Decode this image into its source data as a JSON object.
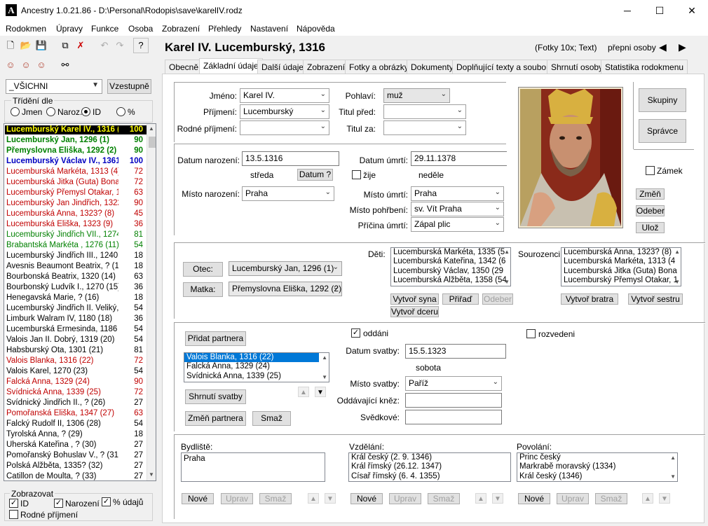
{
  "window": {
    "title": "Ancestry 1.0.21.86 - D:\\Personal\\Rodopis\\save\\karelIV.rodz",
    "app_icon": "A",
    "minimize": "─",
    "maximize": "☐",
    "close": "✕"
  },
  "menu": [
    "Rodokmen",
    "Úpravy",
    "Funkce",
    "Osoba",
    "Zobrazení",
    "Přehledy",
    "Nastavení",
    "Nápověda"
  ],
  "left": {
    "filter": "_VŠICHNI",
    "sort_direction_button": "Vzestupně",
    "sort_label": "Třídění dle",
    "sort_options": [
      "Jmen",
      "Naroz.",
      "ID",
      "%"
    ],
    "sort_selected": "ID",
    "persons": [
      {
        "name": "Lucemburský Karel IV., 1316 (1)",
        "num": "100",
        "color": "#000000",
        "bold": true,
        "selected": true
      },
      {
        "name": "Lucemburský Jan, 1296 (1)",
        "num": "90",
        "color": "#008000",
        "bold": true
      },
      {
        "name": "Přemyslovna Eliška, 1292 (2)",
        "num": "90",
        "color": "#008000",
        "bold": true
      },
      {
        "name": "Lucemburský Václav IV., 1361",
        "num": "100",
        "color": "#0000c0",
        "bold": true
      },
      {
        "name": "Lucemburská Markéta, 1313 (4)",
        "num": "72",
        "color": "#c00000"
      },
      {
        "name": "Lucemburská Jitka (Guta) Bona, 1",
        "num": "72",
        "color": "#c00000"
      },
      {
        "name": "Lucemburský Přemysl Otakar, 1318",
        "num": "63",
        "color": "#c00000"
      },
      {
        "name": "Lucemburský Jan Jindřich, 1322 (",
        "num": "90",
        "color": "#c00000"
      },
      {
        "name": "Lucemburská Anna, 1323? (8)",
        "num": "45",
        "color": "#c00000"
      },
      {
        "name": "Lucemburská Eliška, 1323 (9)",
        "num": "36",
        "color": "#c00000"
      },
      {
        "name": "Lucemburský Jindřich VII., 1274 (",
        "num": "81",
        "color": "#008000"
      },
      {
        "name": "Brabantská Markéta , 1276 (11)",
        "num": "54",
        "color": "#008000"
      },
      {
        "name": "Lucemburský Jindřich III., 1240 (1",
        "num": "18",
        "color": "#000000"
      },
      {
        "name": "Avesnis Beaumont Beatrix, ? (13)",
        "num": "18",
        "color": "#000000"
      },
      {
        "name": "Bourbonská Beatrix, 1320 (14)",
        "num": "63",
        "color": "#000000"
      },
      {
        "name": "Bourbonský Ludvík I., 1270 (15)",
        "num": "36",
        "color": "#000000"
      },
      {
        "name": "Henegavská Marie, ? (16)",
        "num": "18",
        "color": "#000000"
      },
      {
        "name": "Lucemburský Jindřich II. Veliký, 1",
        "num": "54",
        "color": "#000000"
      },
      {
        "name": "Limburk Walram IV, 1180 (18)",
        "num": "36",
        "color": "#000000"
      },
      {
        "name": "Lucemburská Ermesinda, 1186 (1",
        "num": "54",
        "color": "#000000"
      },
      {
        "name": "Valois Jan II. Dobrý, 1319 (20)",
        "num": "54",
        "color": "#000000"
      },
      {
        "name": "Habsburský Ota, 1301 (21)",
        "num": "81",
        "color": "#000000"
      },
      {
        "name": "Valois Blanka, 1316 (22)",
        "num": "72",
        "color": "#c00000"
      },
      {
        "name": "Valois Karel, 1270 (23)",
        "num": "54",
        "color": "#000000"
      },
      {
        "name": "Falcká Anna, 1329 (24)",
        "num": "90",
        "color": "#c00000"
      },
      {
        "name": "Svídnická Anna, 1339 (25)",
        "num": "72",
        "color": "#c00000"
      },
      {
        "name": "Svídnický Jindřich II., ? (26)",
        "num": "27",
        "color": "#000000"
      },
      {
        "name": "Pomořanská Eliška, 1347 (27)",
        "num": "63",
        "color": "#c00000"
      },
      {
        "name": "Falcký Rudolf II, 1306 (28)",
        "num": "54",
        "color": "#000000"
      },
      {
        "name": "Tyrolská Anna, ? (29)",
        "num": "18",
        "color": "#000000"
      },
      {
        "name": "Uherská Kateřina , ? (30)",
        "num": "27",
        "color": "#000000"
      },
      {
        "name": "Pomořanský Bohuslav V., ? (31)",
        "num": "27",
        "color": "#000000"
      },
      {
        "name": "Polská Alžběta, 1335? (32)",
        "num": "27",
        "color": "#000000"
      },
      {
        "name": "Catillon de Moulta, ? (33)",
        "num": "27",
        "color": "#000000"
      }
    ],
    "display_group": "Zobrazovat",
    "display_opts": [
      {
        "label": "ID",
        "checked": true
      },
      {
        "label": "Narození",
        "checked": true
      },
      {
        "label": "% údajů",
        "checked": true
      },
      {
        "label": "Rodné příjmení",
        "checked": false
      }
    ]
  },
  "header": {
    "person": "Karel IV. Lucemburský, 1316",
    "photos": "(Fotky 10x; Text)",
    "switch": "přepni osoby"
  },
  "tabs": [
    "Obecně",
    "Základní údaje",
    "Další údaje",
    "Zobrazení",
    "Fotky a obrázky",
    "Dokumenty",
    "Doplňující texty a soubory",
    "Shrnutí osoby",
    "Statistika rodokmenu"
  ],
  "active_tab": 1,
  "basic": {
    "name_label": "Jméno:",
    "name": "Karel IV.",
    "surname_label": "Příjmení:",
    "surname": "Lucemburský",
    "birth_surname_label": "Rodné příjmení:",
    "birth_surname": "",
    "sex_label": "Pohlaví:",
    "sex": "muž",
    "title_before_label": "Titul před:",
    "title_before": "",
    "title_after_label": "Titul za:",
    "title_after": "",
    "birth_date_label": "Datum narození:",
    "birth_date": "13.5.1316",
    "birth_weekday": "středa",
    "date_button": "Datum ?",
    "birth_place_label": "Místo narození:",
    "birth_place": "Praha",
    "death_date_label": "Datum úmrtí:",
    "death_date": "29.11.1378",
    "alive_label": "žije",
    "death_weekday": "neděle",
    "death_place_label": "Místo úmrtí:",
    "death_place": "Praha",
    "burial_place_label": "Místo pohřbení:",
    "burial_place": "sv. Vít Praha",
    "death_cause_label": "Příčina úmrtí:",
    "death_cause": "Zápal plic"
  },
  "side": {
    "groups": "Skupiny",
    "admin": "Správce",
    "lock": "Zámek",
    "change": "Změň",
    "remove": "Odeber",
    "save": "Ulož"
  },
  "family": {
    "father_btn": "Otec:",
    "father": "Lucemburský Jan, 1296 (1)",
    "mother_btn": "Matka:",
    "mother": "Přemyslovna Eliška, 1292 (2)",
    "children_label": "Děti:",
    "children": [
      "Lucemburská Markéta, 1335 (5",
      "Lucemburská Kateřina, 1342 (6",
      "Lucemburský Václav, 1350 (29",
      "Lucemburská  Alžběta, 1358 (54"
    ],
    "create_son": "Vytvoř syna",
    "assign": "Přiřaď",
    "remove": "Odeber",
    "create_daughter": "Vytvoř dceru",
    "siblings_label": "Sourozenci:",
    "siblings": [
      "Lucemburská Anna, 1323? (8)",
      "Lucemburská Markéta, 1313 (4",
      "Lucemburská Jitka (Guta) Bona",
      "Lucemburský Přemysl Otakar, 1"
    ],
    "create_brother": "Vytvoř bratra",
    "create_sister": "Vytvoř sestru"
  },
  "marriage": {
    "add_partner": "Přidat partnera",
    "partners": [
      "Valois Blanka, 1316 (22)",
      "Falcká Anna, 1329 (24)",
      "Svídnická Anna, 1339 (25)"
    ],
    "summary": "Shrnutí svatby",
    "change_partner": "Změň partnera",
    "delete": "Smaž",
    "married_label": "oddáni",
    "divorced_label": "rozvedeni",
    "wedding_date_label": "Datum svatby:",
    "wedding_date": "15.5.1323",
    "wedding_weekday": "sobota",
    "wedding_place_label": "Místo svatby:",
    "wedding_place": "Paříž",
    "priest_label": "Oddávající kněz:",
    "priest": "",
    "witnesses_label": "Svědkové:",
    "witnesses": ""
  },
  "bottom": {
    "residence_label": "Bydliště:",
    "residence": [
      "Praha"
    ],
    "education_label": "Vzdělání:",
    "education": [
      "Král český (2. 9. 1346)",
      "Král římský (26.12. 1347)",
      "Císař římský (6. 4. 1355)"
    ],
    "profession_label": "Povolání:",
    "profession": [
      "Princ český",
      "Markrabě moravský (1334)",
      "Král český (1346)"
    ],
    "new": "Nové",
    "edit": "Uprav",
    "delete": "Smaž"
  },
  "colors": {
    "selected_bg": "#000000",
    "selected_fg": "#ffff00",
    "highlight": "#0078d7"
  }
}
